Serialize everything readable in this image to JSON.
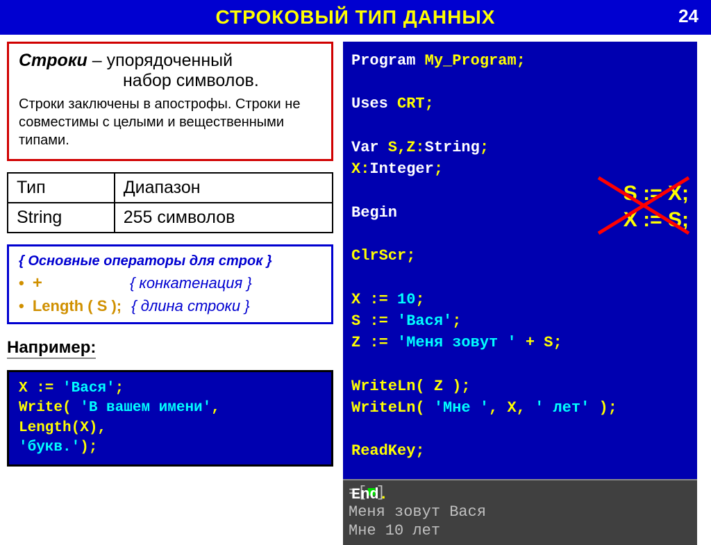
{
  "header": {
    "title": "СТРОКОВЫЙ ТИП ДАННЫХ",
    "page_number": "24"
  },
  "definition": {
    "term": "Строки",
    "line1_after": " – упорядоченный",
    "line2": "набор символов.",
    "note": "Строки заключены в апострофы. Строки не совместимы с целыми и вещественными типами."
  },
  "type_table": {
    "headers": [
      "Тип",
      "Диапазон"
    ],
    "rows": [
      [
        "String",
        "255 символов"
      ]
    ]
  },
  "operators": {
    "title": "{ Основные операторы для строк }",
    "items": [
      {
        "symbol": "+",
        "comment": "{ конкатенация }"
      },
      {
        "symbol": "Length ( S );",
        "comment": "{ длина строки }"
      }
    ]
  },
  "example_label": "Например:",
  "example_code": {
    "l1a": "X := ",
    "l1b": "'Вася'",
    "l1c": ";",
    "l2a": "Write",
    "l2b": "( ",
    "l2c": "'В вашем имени'",
    "l2d": ",",
    "l3a": "       Length",
    "l3b": "(X),",
    "l4a": "       ",
    "l4b": "'букв.'",
    "l4c": ");"
  },
  "main_code": {
    "l1": {
      "kw": "Program",
      "rest": " My_Program;"
    },
    "l2": {
      "kw": "Uses",
      "rest": " CRT;"
    },
    "l3": {
      "kw": "Var",
      "rest1": " S,Z:",
      "kw2": "String",
      "rest2": ";"
    },
    "l4": {
      "indent": "    ",
      "rest1": "X:",
      "kw2": "Integer",
      "rest2": ";"
    },
    "l5": {
      "kw": "Begin"
    },
    "l6": {
      "rest": " ClrScr;"
    },
    "l7": {
      "rest1": " X := ",
      "val": "10",
      "rest2": ";"
    },
    "l8": {
      "rest1": " S := ",
      "val": "'Вася'",
      "rest2": ";"
    },
    "l9": {
      "rest1": " Z := ",
      "val": "'Меня зовут '",
      "rest2": " + S;"
    },
    "l10": {
      "fn": " WriteLn",
      "rest": "( Z );"
    },
    "l11": {
      "fn": " WriteLn",
      "rest1": "( ",
      "s1": "'Мне '",
      "c1": ", X, ",
      "s2": "' лет'",
      "rest2": " );"
    },
    "l12": {
      "fn": " ReadKey",
      "rest": ";"
    },
    "l13": {
      "kw": "End",
      "rest": "."
    }
  },
  "error_overlay": {
    "l1": "S := X;",
    "l2": "X := S;"
  },
  "output": {
    "prompt_open": "=[",
    "prompt_close": "]",
    "l1": "Меня зовут Вася",
    "l2": "Мне 10 лет"
  }
}
